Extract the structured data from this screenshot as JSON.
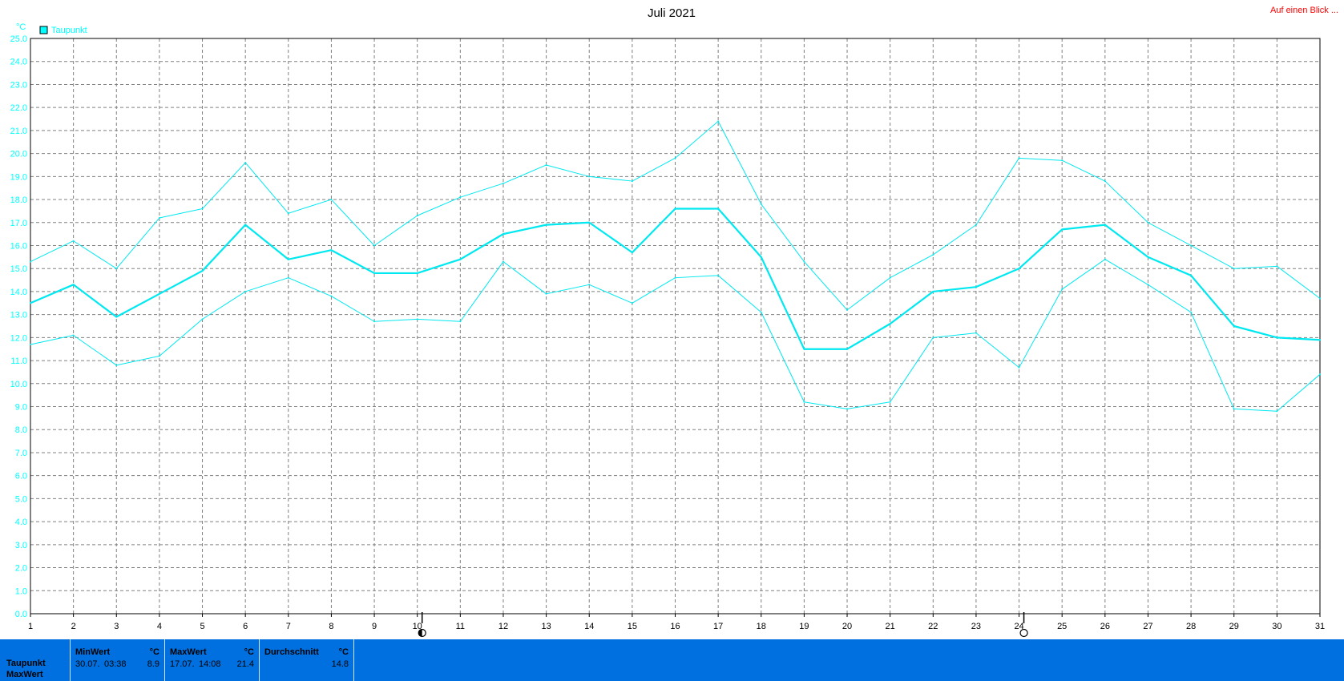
{
  "title": "Juli 2021",
  "link": {
    "label": "Auf einen Blick ...",
    "color": "#ff0000"
  },
  "legend": {
    "label": "Taupunkt",
    "color": "#00ffff"
  },
  "unit": "°C",
  "colors": {
    "series": "#00e8f0",
    "axis_text": "#00ffff",
    "grid": "#808080",
    "stats_bg": "#0070e0"
  },
  "chart_data": {
    "type": "line",
    "title": "Juli 2021",
    "ylabel": "°C",
    "ylim": [
      0,
      25
    ],
    "y_ticks": [
      "0.0",
      "1.0",
      "2.0",
      "3.0",
      "4.0",
      "5.0",
      "6.0",
      "7.0",
      "8.0",
      "9.0",
      "10.0",
      "11.0",
      "12.0",
      "13.0",
      "14.0",
      "15.0",
      "16.0",
      "17.0",
      "18.0",
      "19.0",
      "20.0",
      "21.0",
      "22.0",
      "23.0",
      "24.0",
      "25.0"
    ],
    "x": [
      "1",
      "2",
      "3",
      "4",
      "5",
      "6",
      "7",
      "8",
      "9",
      "10",
      "11",
      "12",
      "13",
      "14",
      "15",
      "16",
      "17",
      "18",
      "19",
      "20",
      "21",
      "22",
      "23",
      "24",
      "25",
      "26",
      "27",
      "28",
      "29",
      "30",
      "31"
    ],
    "grid": true,
    "legend_position": "top-left",
    "series": [
      {
        "name": "Taupunkt",
        "role": "average",
        "values": [
          13.5,
          14.3,
          12.9,
          13.9,
          14.9,
          16.9,
          15.4,
          15.8,
          14.8,
          14.8,
          15.4,
          16.5,
          16.9,
          17.0,
          15.7,
          17.6,
          17.6,
          15.5,
          11.5,
          11.5,
          12.6,
          14.0,
          14.2,
          15.0,
          16.7,
          16.9,
          15.5,
          14.7,
          12.5,
          12.0,
          11.9
        ]
      },
      {
        "role": "max",
        "values": [
          15.3,
          16.2,
          15.0,
          17.2,
          17.6,
          19.6,
          17.4,
          18.0,
          16.0,
          17.3,
          18.1,
          18.7,
          19.5,
          19.0,
          18.8,
          19.8,
          21.4,
          17.8,
          15.3,
          13.2,
          14.6,
          15.6,
          16.9,
          19.8,
          19.7,
          18.8,
          17.0,
          16.0,
          15.0,
          15.1,
          13.7
        ]
      },
      {
        "role": "min",
        "values": [
          11.7,
          12.1,
          10.8,
          11.2,
          12.8,
          14.0,
          14.6,
          13.8,
          12.7,
          12.8,
          12.7,
          15.3,
          13.9,
          14.3,
          13.5,
          14.6,
          14.7,
          13.1,
          9.2,
          8.9,
          9.2,
          12.0,
          12.2,
          10.7,
          14.1,
          15.4,
          14.3,
          13.1,
          8.9,
          8.8,
          10.4
        ]
      }
    ],
    "moon_markers": [
      {
        "day": 10,
        "phase": "third-quarter"
      },
      {
        "day": 24,
        "phase": "full-moon"
      }
    ]
  },
  "stats": {
    "row_labels": [
      "Taupunkt",
      "MaxWert"
    ],
    "columns": [
      {
        "header": "MinWert",
        "unit": "°C",
        "date": "30.07.",
        "time": "03:38",
        "value": "8.9"
      },
      {
        "header": "MaxWert",
        "unit": "°C",
        "date": "17.07.",
        "time": "14:08",
        "value": "21.4"
      },
      {
        "header": "Durchschnitt",
        "unit": "°C",
        "date": "",
        "time": "",
        "value": "14.8"
      }
    ]
  }
}
